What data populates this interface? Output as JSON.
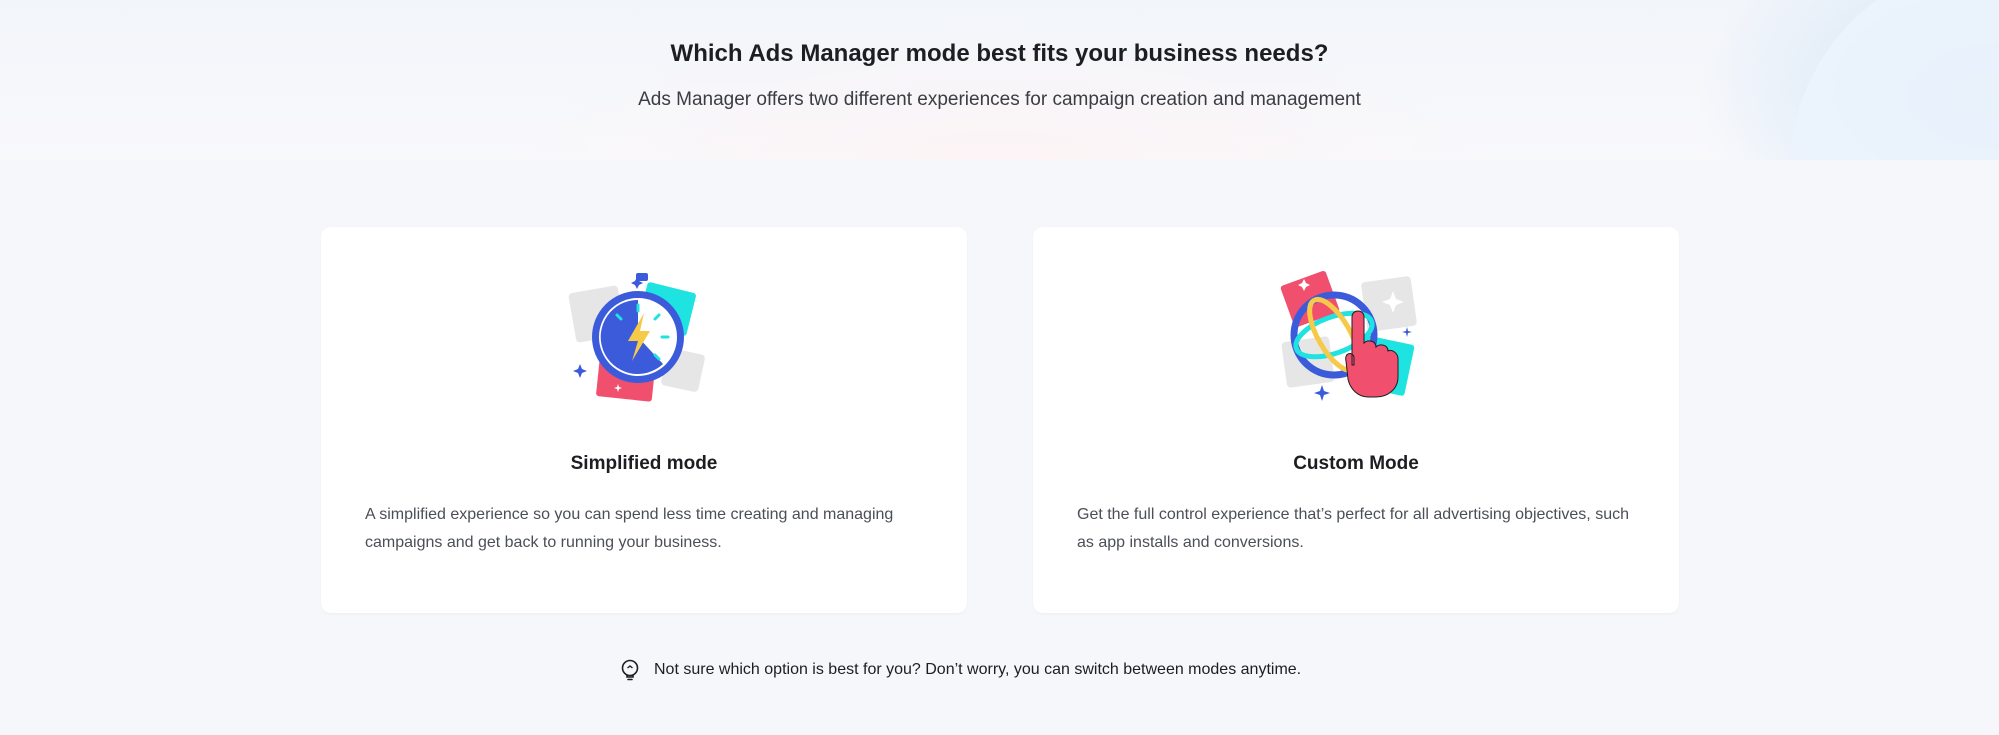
{
  "header": {
    "title": "Which Ads Manager mode best fits your business needs?",
    "subtitle": "Ads Manager offers two different experiences for campaign creation and management"
  },
  "modes": [
    {
      "title": "Simplified mode",
      "description": "A simplified experience so you can spend less time creating and managing campaigns and get back to running your business.",
      "icon": "stopwatch-lightning-illustration"
    },
    {
      "title": "Custom Mode",
      "description": "Get the full control experience that’s perfect for all advertising objectives, such as app installs and conversions.",
      "icon": "globe-hand-illustration"
    }
  ],
  "tip": {
    "text": "Not sure which option is best for you? Don’t worry, you can switch between modes anytime.",
    "icon": "lightbulb-icon"
  },
  "colors": {
    "background": "#f6f7fa",
    "card": "#ffffff",
    "blue": "#3b5bdb",
    "cyan": "#1ee3e0",
    "pink": "#f0506e",
    "yellow": "#f7c948"
  }
}
